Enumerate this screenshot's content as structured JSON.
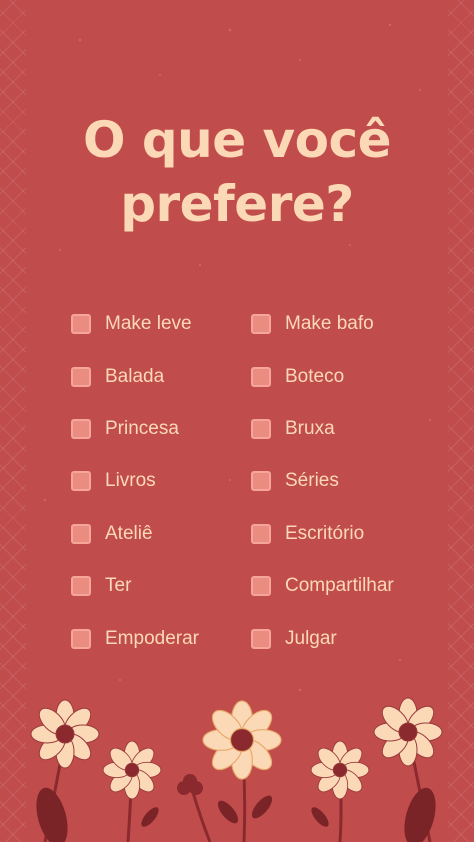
{
  "title": {
    "line1": "O que você",
    "line2": "prefere?"
  },
  "options_left": [
    {
      "label": "Make leve"
    },
    {
      "label": "Balada"
    },
    {
      "label": "Princesa"
    },
    {
      "label": "Livros"
    },
    {
      "label": "Ateliê"
    },
    {
      "label": "Ter"
    },
    {
      "label": "Empoderar"
    }
  ],
  "options_right": [
    {
      "label": "Make bafo"
    },
    {
      "label": "Boteco"
    },
    {
      "label": "Bruxa"
    },
    {
      "label": "Séries"
    },
    {
      "label": "Escritório"
    },
    {
      "label": "Compartilhar"
    },
    {
      "label": "Julgar"
    }
  ],
  "colors": {
    "background": "#c14c4c",
    "text": "#fbd9b6",
    "checkbox": "#ea8c80"
  }
}
